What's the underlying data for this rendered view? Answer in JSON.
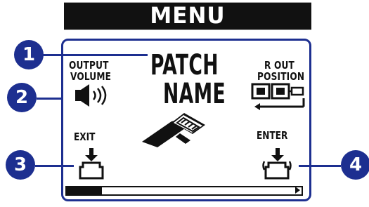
{
  "header": {
    "title": "MENU"
  },
  "labels": {
    "output_volume_1": "OUTPUT",
    "output_volume_2": "VOLUME",
    "patch_name_1": "PATCH",
    "patch_name_2": "NAME",
    "r_out_position_1": "R OUT",
    "r_out_position_2": "POSITION",
    "exit": "EXIT",
    "enter": "ENTER"
  },
  "callouts": {
    "one": "1",
    "two": "2",
    "three": "3",
    "four": "4"
  },
  "icons": {
    "volume": "speaker-icon",
    "position": "routing-icon",
    "patch": "pedal-icon",
    "exit": "footswitch-icon",
    "enter": "footswitch-icon"
  },
  "colors": {
    "accent": "#1d2f90",
    "text": "#111111",
    "background": "#ffffff"
  },
  "slider": {
    "position": 0.15
  }
}
